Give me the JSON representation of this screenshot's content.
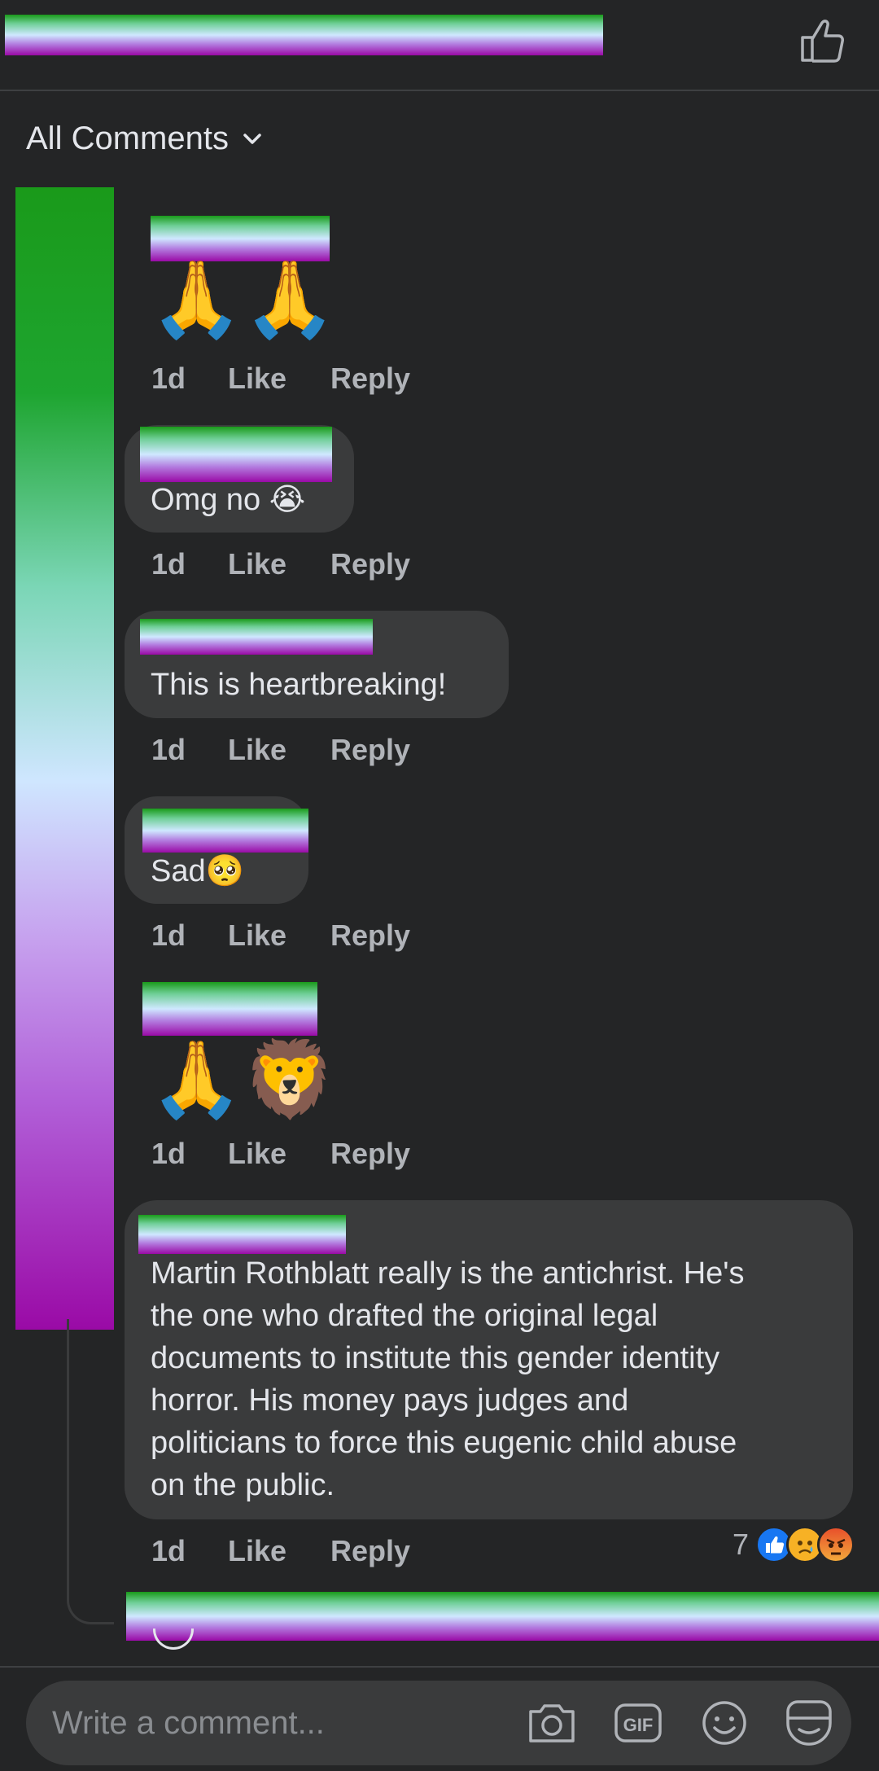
{
  "filter": {
    "label": "All Comments"
  },
  "comments": [
    {
      "text": "🙏🙏",
      "time": "1d",
      "like": "Like",
      "reply": "Reply"
    },
    {
      "text": "Omg no 😭",
      "time": "1d",
      "like": "Like",
      "reply": "Reply"
    },
    {
      "text": "This is heartbreaking!",
      "time": "1d",
      "like": "Like",
      "reply": "Reply"
    },
    {
      "text": "Sad🥺",
      "time": "1d",
      "like": "Like",
      "reply": "Reply"
    },
    {
      "text": "🙏🦁",
      "time": "1d",
      "like": "Like",
      "reply": "Reply"
    },
    {
      "lines": [
        "Martin Rothblatt really is the antichrist. He's",
        "the one who drafted the original legal",
        "documents to institute this gender identity",
        "horror. His money pays judges and",
        "politicians to force this eugenic child abuse",
        "on the public."
      ],
      "time": "1d",
      "like": "Like",
      "reply": "Reply",
      "reactions": {
        "count": "7",
        "icons": [
          "like-reaction",
          "sad-reaction",
          "angry-reaction"
        ]
      }
    }
  ],
  "composer": {
    "placeholder": "Write a comment..."
  },
  "icons": [
    "thumbs-up-icon",
    "chevron-down-icon",
    "camera-icon",
    "gif-icon",
    "emoji-icon",
    "sticker-icon"
  ],
  "colors": {
    "background": "#242526",
    "bubble": "#3a3b3c",
    "muted": "#b0b3b8",
    "like_blue": "#1877f2",
    "angry": "#e8502b",
    "sad": "#f7b125"
  }
}
